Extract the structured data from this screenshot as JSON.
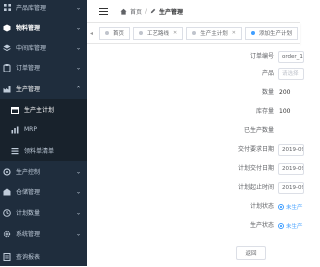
{
  "sidebar": {
    "items": [
      {
        "label": "产品库管理",
        "icon": "grid-icon",
        "arrow": "⌄"
      },
      {
        "label": "物料管理",
        "icon": "cube-icon",
        "arrow": "⌄"
      },
      {
        "label": "中间库管理",
        "icon": "layers-icon",
        "arrow": "⌄"
      },
      {
        "label": "订单管理",
        "icon": "clipboard-icon",
        "arrow": "⌄"
      },
      {
        "label": "生产管理",
        "icon": "factory-icon",
        "arrow": "⌃"
      },
      {
        "label": "生产主计划",
        "icon": "calendar-icon",
        "arrow": ""
      },
      {
        "label": "MRP",
        "icon": "chart-icon",
        "arrow": ""
      },
      {
        "label": "领料单清单",
        "icon": "list-icon",
        "arrow": ""
      },
      {
        "label": "生产控制",
        "icon": "control-icon",
        "arrow": "⌄"
      },
      {
        "label": "仓储管理",
        "icon": "warehouse-icon",
        "arrow": "⌄"
      },
      {
        "label": "计划数量",
        "icon": "plan-icon",
        "arrow": "⌄"
      },
      {
        "label": "系统管理",
        "icon": "settings-icon",
        "arrow": "⌄"
      },
      {
        "label": "查询报表",
        "icon": "report-icon",
        "arrow": ""
      }
    ]
  },
  "header": {
    "home_label": "首页",
    "separator": "/",
    "current_label": "生产管理"
  },
  "tabs": {
    "left_arrow": "◂",
    "items": [
      {
        "label": "首页",
        "closable": false
      },
      {
        "label": "工艺路线",
        "closable": true
      },
      {
        "label": "生产主计划",
        "closable": true
      },
      {
        "label": "添加生产计划",
        "closable": true
      }
    ]
  },
  "form": {
    "order_no_label": "订单编号",
    "order_no_value": "order_10",
    "product_label": "产品",
    "product_placeholder": "请选择",
    "quantity_label": "数量",
    "quantity_value": "200",
    "stock_label": "库存量",
    "stock_value": "100",
    "produced_label": "已生产数量",
    "produced_value": "",
    "delivery_req_label": "交付要求日期",
    "delivery_req_value": "2019-09",
    "plan_delivery_label": "计划交付日期",
    "plan_delivery_value": "2019-09",
    "plan_start_end_label": "计划起止时间",
    "plan_start_end_value": "2019-09",
    "plan_status_label": "计划状态",
    "plan_status_option": "未生产",
    "produce_status_label": "生产状态",
    "produce_status_option": "未生产",
    "back_button": "返回"
  },
  "colors": {
    "sidebar_bg": "#1f2d3d",
    "sidebar_sub_bg": "#18222c",
    "accent": "#409eff"
  }
}
